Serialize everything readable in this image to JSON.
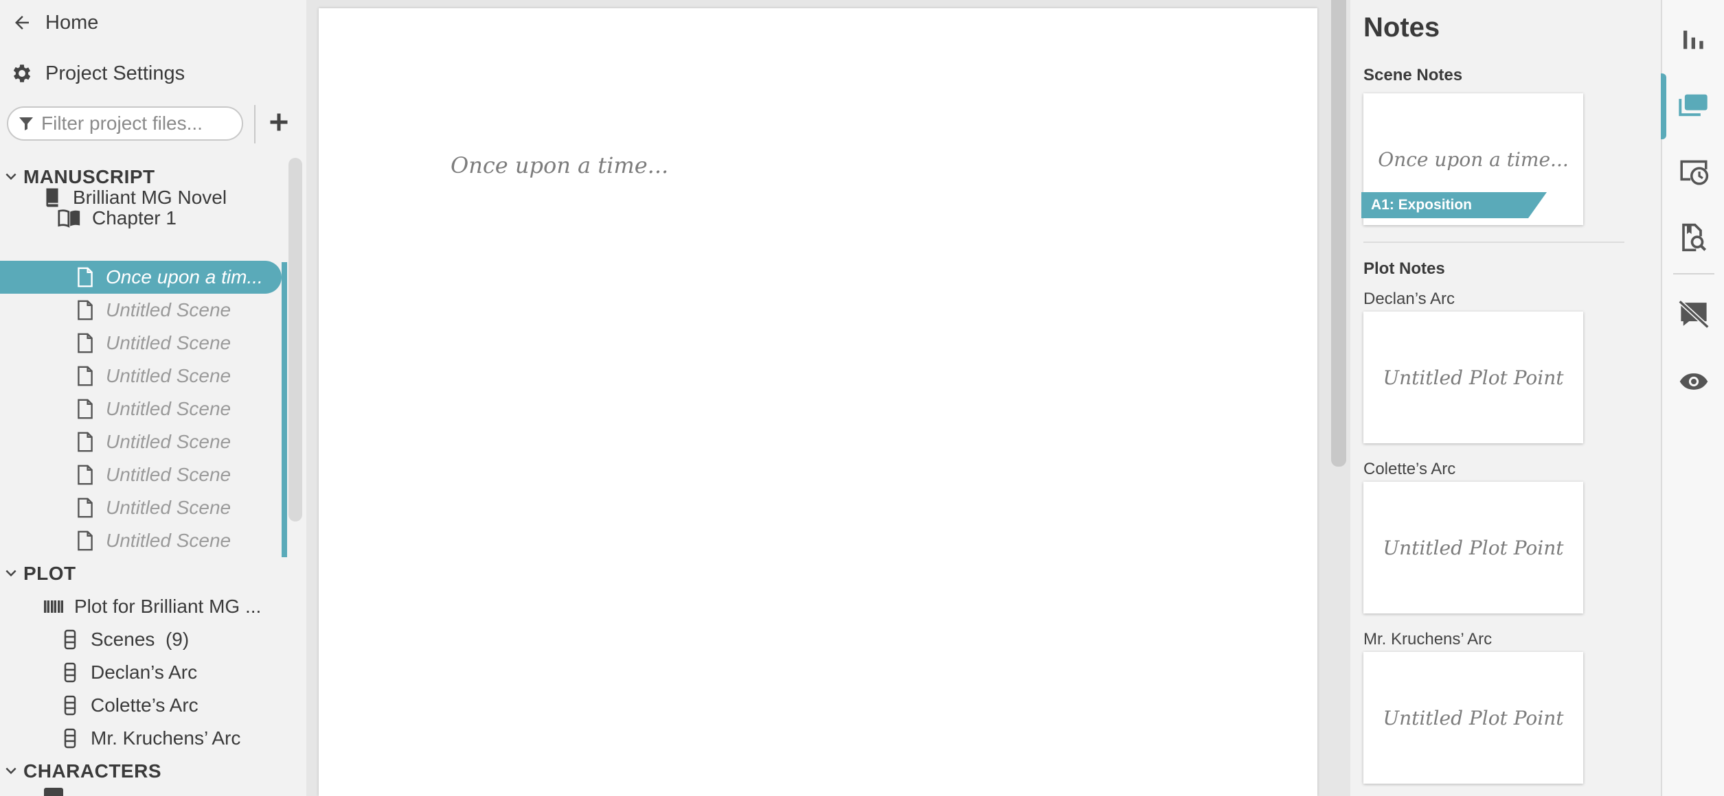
{
  "sidebar": {
    "home_label": "Home",
    "settings_label": "Project Settings",
    "filter_placeholder": "Filter project files...",
    "sections": {
      "manuscript": {
        "label": "MANUSCRIPT",
        "book": "Brilliant MG Novel",
        "chapter": "Chapter 1",
        "scenes": [
          "Once upon a tim...",
          "Untitled Scene",
          "Untitled Scene",
          "Untitled Scene",
          "Untitled Scene",
          "Untitled Scene",
          "Untitled Scene",
          "Untitled Scene",
          "Untitled Scene"
        ]
      },
      "plot": {
        "label": "PLOT",
        "board": "Plot for Brilliant MG ...",
        "lines": [
          "Scenes  (9)",
          "Declan’s Arc",
          "Colette’s Arc",
          "Mr. Kruchens’ Arc"
        ]
      },
      "characters": {
        "label": "CHARACTERS"
      }
    },
    "icons": {
      "back": "arrow-left-icon",
      "settings": "gear-icon",
      "filter": "filter-icon",
      "add": "plus-icon",
      "book": "book-icon",
      "chapter": "open-book-icon",
      "scene": "document-icon",
      "plot": "columns-icon",
      "plotline": "plotline-icon"
    }
  },
  "editor": {
    "text": "Once upon a time..."
  },
  "notes": {
    "title": "Notes",
    "scene_notes_label": "Scene Notes",
    "scene_card_text": "Once upon a time...",
    "scene_tag": "A1: Exposition",
    "plot_notes_label": "Plot Notes",
    "arcs": [
      {
        "name": "Declan’s Arc",
        "card": "Untitled Plot Point"
      },
      {
        "name": "Colette’s Arc",
        "card": "Untitled Plot Point"
      },
      {
        "name": "Mr. Kruchens’ Arc",
        "card": "Untitled Plot Point"
      }
    ]
  },
  "rail": {
    "icons": [
      "bar-chart-icon",
      "notes-cards-icon",
      "history-icon",
      "search-document-icon",
      "hide-comments-icon",
      "eye-icon"
    ],
    "active": "notes-cards-icon"
  },
  "colors": {
    "accent": "#5aaab9",
    "sidebar_bg": "#f2f2f2",
    "editor_bg": "#e6e6e6",
    "text": "#3a3a3a",
    "muted_text": "#9a9a9a"
  }
}
